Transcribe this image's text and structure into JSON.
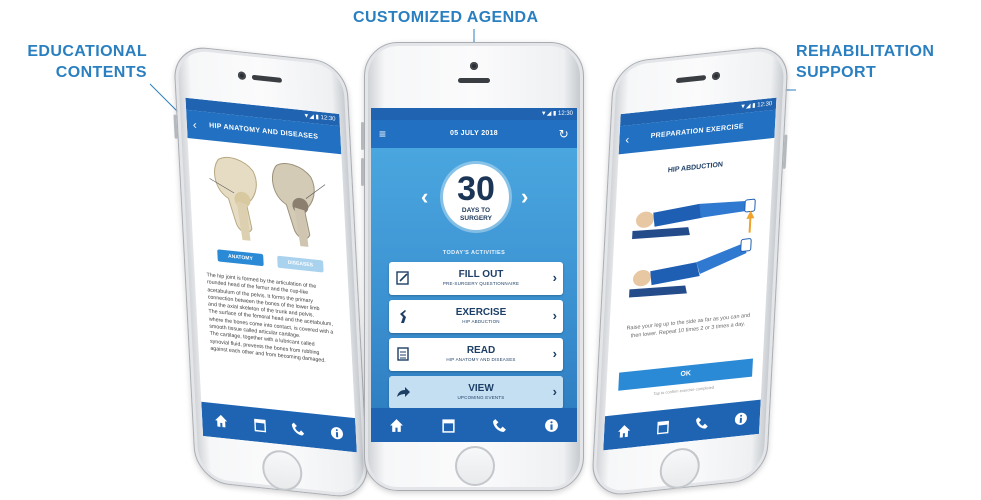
{
  "captions": {
    "left": [
      "EDUCATIONAL",
      "CONTENTS"
    ],
    "center": "CUSTOMIZED AGENDA",
    "right": [
      "REHABILITATION",
      "SUPPORT"
    ]
  },
  "colors": {
    "caption": "#2a7fc0",
    "app_bar": "#2170c1",
    "agenda_bg": "#3d93d2",
    "card_text": "#1d3f66"
  },
  "phones": {
    "left": {
      "header": "HIP ANATOMY AND DISEASES",
      "status": "▼◢ ▮ 12:30",
      "toggle_labels": [
        "ANATOMY",
        "DISEASES"
      ],
      "paragraph_lines": [
        "The hip joint is formed by the articulation of the",
        "rounded head of the femur and the cup-like",
        "acetabulum of the pelvis. It forms the primary",
        "connection between the bones of the lower limb",
        "and the axial skeleton of the trunk and pelvis.",
        "The surface of the femoral head and the acetabulum,",
        "where the bones come into contact, is covered with a",
        "smooth tissue called articular cartilage.",
        "The cartilage, together with a lubricant called",
        "synovial fluid, prevents the bones from rubbing",
        "against each other and from becoming damaged."
      ],
      "tabs": [
        "home-icon",
        "calendar-icon",
        "phone-icon",
        "info-icon"
      ]
    },
    "center": {
      "status": "▼◢ ▮ 12:30",
      "date": "05 JULY 2018",
      "counter": {
        "value": "30",
        "label_lines": [
          "DAYS TO",
          "SURGERY"
        ]
      },
      "activities_title": "TODAY'S ACTIVITIES",
      "cards": [
        {
          "icon": "form-icon",
          "title": "FILL OUT",
          "subtitle": "PRE-SURGERY QUESTIONNAIRE",
          "dim": false
        },
        {
          "icon": "exercise-icon",
          "title": "EXERCISE",
          "subtitle": "HIP ABDUCTION",
          "dim": false
        },
        {
          "icon": "book-icon",
          "title": "READ",
          "subtitle": "HIP ANATOMY AND DISEASES",
          "dim": false
        },
        {
          "icon": "share-icon",
          "title": "VIEW",
          "subtitle": "UPCOMING EVENTS",
          "dim": true
        }
      ],
      "tabs": [
        "home-icon",
        "calendar-icon",
        "phone-icon",
        "info-icon"
      ]
    },
    "right": {
      "status": "▼◢ ▮ 12:30",
      "header": "PREPARATION EXERCISE",
      "exercise_title": "HIP ABDUCTION",
      "instructions_lines": [
        "Raise your leg up to the side as far as you can and",
        "then lower. Repeat 10 times 2 or 3 times a day."
      ],
      "ok_label": "OK",
      "ok_note": "Tap to confirm exercise completed",
      "tabs": [
        "home-icon",
        "calendar-icon",
        "phone-icon",
        "info-icon"
      ]
    }
  }
}
